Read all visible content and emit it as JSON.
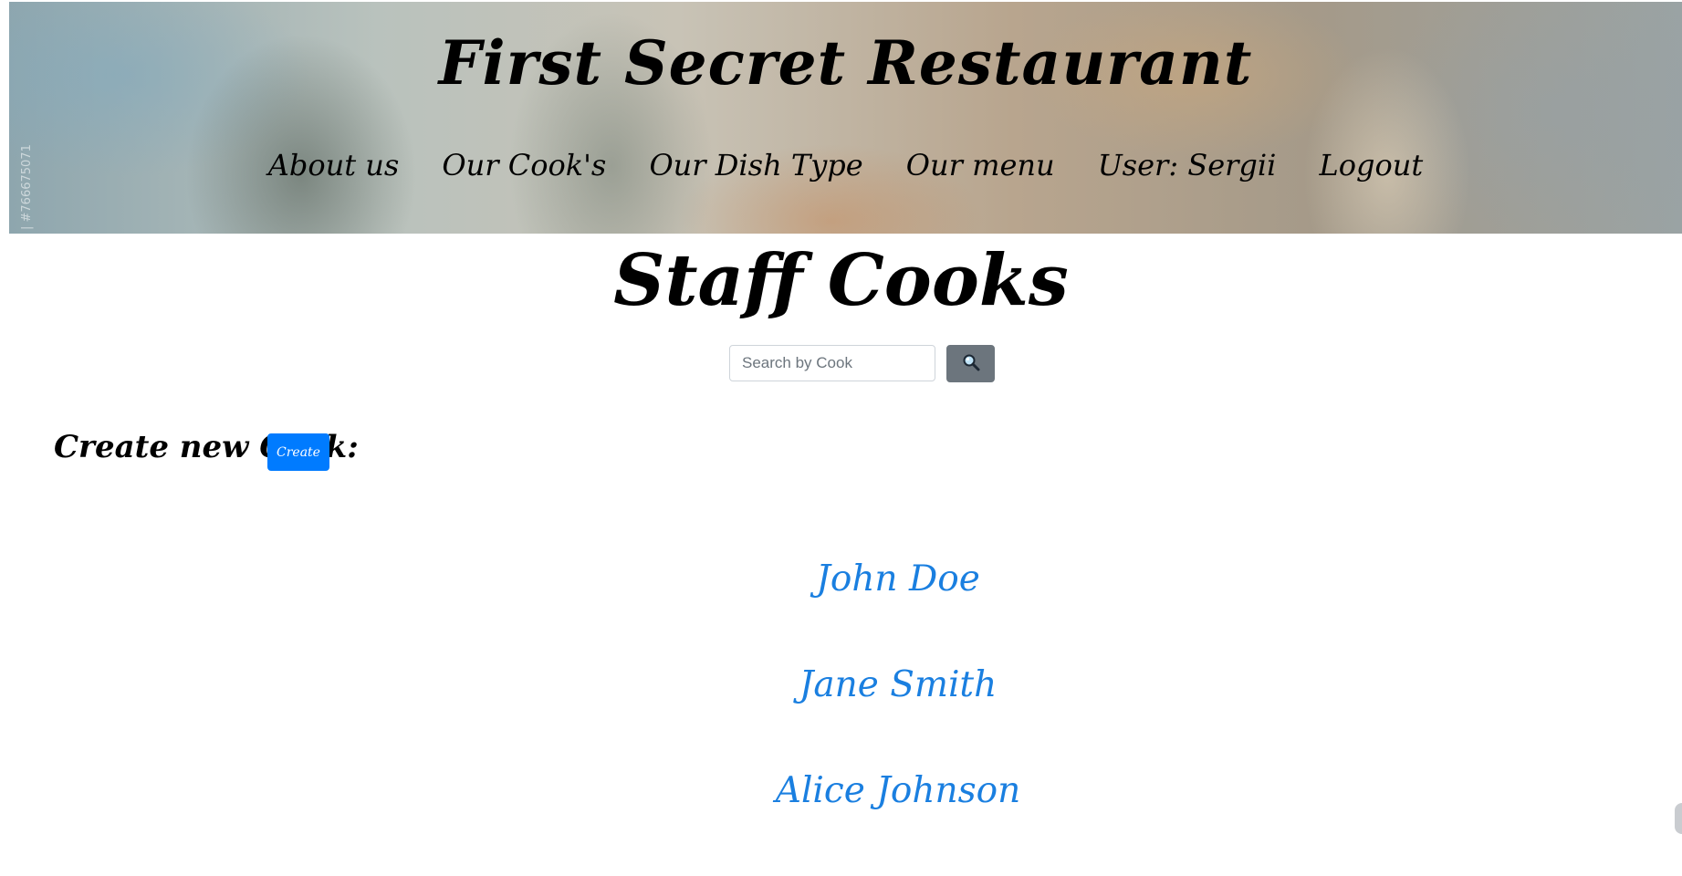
{
  "header": {
    "site_title": "First Secret Restaurant",
    "watermark": "| #766675071",
    "nav": [
      {
        "label": "About us"
      },
      {
        "label": "Our Cook's"
      },
      {
        "label": "Our Dish Type"
      },
      {
        "label": "Our menu"
      },
      {
        "label": "User: Sergii"
      },
      {
        "label": "Logout"
      }
    ]
  },
  "main": {
    "heading": "Staff Cooks",
    "search": {
      "placeholder": "Search by Cook",
      "value": "",
      "button_icon": "search-icon"
    },
    "create": {
      "label": "Create new Cook:",
      "button_label": "Create"
    },
    "cooks": [
      {
        "name": "John Doe"
      },
      {
        "name": "Jane Smith"
      },
      {
        "name": "Alice Johnson"
      }
    ]
  },
  "colors": {
    "link": "#1a7fe0",
    "primary_button": "#007bff",
    "secondary_button": "#6c757d",
    "text": "#000000"
  }
}
